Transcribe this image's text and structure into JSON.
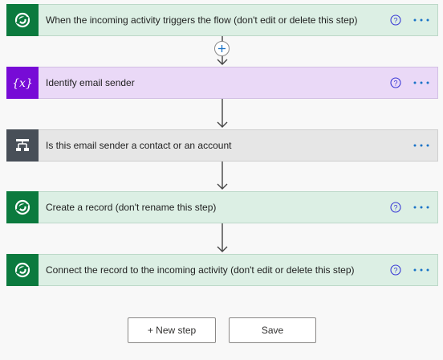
{
  "steps": [
    {
      "title": "When the incoming activity triggers the flow (don't edit or delete this step)",
      "icon": "dataverse-icon",
      "color": "teal",
      "has_help": true
    },
    {
      "title": "Identify email sender",
      "icon": "variable-icon",
      "color": "purple",
      "has_help": true
    },
    {
      "title": "Is this email sender a contact or an account",
      "icon": "condition-icon",
      "color": "gray",
      "has_help": false
    },
    {
      "title": "Create a record (don't rename this step)",
      "icon": "dataverse-icon",
      "color": "teal",
      "has_help": true
    },
    {
      "title": "Connect the record to the incoming activity (don't edit or delete this step)",
      "icon": "dataverse-icon",
      "color": "teal",
      "has_help": true
    }
  ],
  "buttons": {
    "new_step_label": "+ New step",
    "save_label": "Save"
  },
  "colors": {
    "dataverse": "#0b7a3e",
    "variable": "#770bd6",
    "condition": "#484f58",
    "help_accent": "#3a3ad6",
    "more_accent": "#1a73c7"
  }
}
